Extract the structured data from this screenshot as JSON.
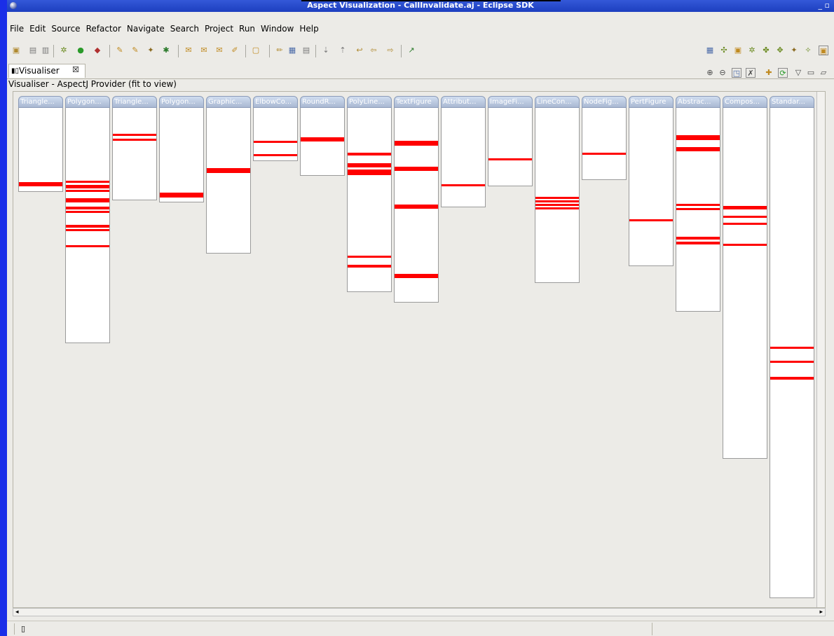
{
  "window": {
    "title": "Aspect Visualization - CallInvalidate.aj - Eclipse SDK",
    "controls": "_ ▫"
  },
  "menu": [
    "File",
    "Edit",
    "Source",
    "Refactor",
    "Navigate",
    "Search",
    "Project",
    "Run",
    "Window",
    "Help"
  ],
  "view": {
    "tab_label": "Visualiser",
    "close_glyph": "☒",
    "provider_label": "Visualiser - AspectJ Provider (fit to view)"
  },
  "colors": {
    "stripe": "#ff0000",
    "header": "#a9b8d2",
    "background": "#ecebe7"
  },
  "columns": [
    {
      "label": "Triangle...",
      "length": 120,
      "stripes": [
        {
          "at": 106,
          "size": 6
        }
      ]
    },
    {
      "label": "Polygon...",
      "length": 336,
      "stripes": [
        {
          "at": 104,
          "size": 3
        },
        {
          "at": 110,
          "size": 5
        },
        {
          "at": 117,
          "size": 3
        },
        {
          "at": 129,
          "size": 6
        },
        {
          "at": 141,
          "size": 4
        },
        {
          "at": 147,
          "size": 3
        },
        {
          "at": 167,
          "size": 4
        },
        {
          "at": 173,
          "size": 3
        },
        {
          "at": 196,
          "size": 3
        }
      ]
    },
    {
      "label": "Triangle...",
      "length": 132,
      "stripes": [
        {
          "at": 37,
          "size": 3
        },
        {
          "at": 44,
          "size": 3
        }
      ]
    },
    {
      "label": "Polygon...",
      "length": 135,
      "stripes": [
        {
          "at": 121,
          "size": 7
        }
      ]
    },
    {
      "label": "Graphic...",
      "length": 208,
      "stripes": [
        {
          "at": 86,
          "size": 7
        }
      ]
    },
    {
      "label": "ElbowCo...",
      "length": 76,
      "stripes": [
        {
          "at": 47,
          "size": 3
        },
        {
          "at": 66,
          "size": 3
        }
      ]
    },
    {
      "label": "RoundR...",
      "length": 97,
      "stripes": [
        {
          "at": 42,
          "size": 6
        }
      ]
    },
    {
      "label": "PolyLine...",
      "length": 263,
      "stripes": [
        {
          "at": 64,
          "size": 4
        },
        {
          "at": 79,
          "size": 6
        },
        {
          "at": 88,
          "size": 8
        },
        {
          "at": 211,
          "size": 3
        },
        {
          "at": 224,
          "size": 4
        }
      ]
    },
    {
      "label": "TextFigure",
      "length": 278,
      "stripes": [
        {
          "at": 47,
          "size": 7
        },
        {
          "at": 84,
          "size": 6
        },
        {
          "at": 138,
          "size": 6
        },
        {
          "at": 237,
          "size": 6
        }
      ]
    },
    {
      "label": "Attribut...",
      "length": 142,
      "stripes": [
        {
          "at": 109,
          "size": 3
        }
      ]
    },
    {
      "label": "ImageFi...",
      "length": 112,
      "stripes": [
        {
          "at": 72,
          "size": 3
        }
      ]
    },
    {
      "label": "LineCon...",
      "length": 250,
      "stripes": [
        {
          "at": 127,
          "size": 3
        },
        {
          "at": 132,
          "size": 3
        },
        {
          "at": 137,
          "size": 3
        },
        {
          "at": 142,
          "size": 3
        }
      ]
    },
    {
      "label": "NodeFig...",
      "length": 103,
      "stripes": [
        {
          "at": 64,
          "size": 3
        }
      ]
    },
    {
      "label": "PertFigure",
      "length": 226,
      "stripes": [
        {
          "at": 159,
          "size": 3
        }
      ]
    },
    {
      "label": "Abstrac...",
      "length": 291,
      "stripes": [
        {
          "at": 39,
          "size": 7
        },
        {
          "at": 56,
          "size": 6
        },
        {
          "at": 137,
          "size": 3
        },
        {
          "at": 143,
          "size": 3
        },
        {
          "at": 184,
          "size": 4
        },
        {
          "at": 191,
          "size": 4
        }
      ]
    },
    {
      "label": "Compos...",
      "length": 501,
      "stripes": [
        {
          "at": 140,
          "size": 5
        },
        {
          "at": 154,
          "size": 3
        },
        {
          "at": 164,
          "size": 3
        },
        {
          "at": 194,
          "size": 3
        }
      ]
    },
    {
      "label": "Standar...",
      "length": 700,
      "stripes": [
        {
          "at": 341,
          "size": 3
        },
        {
          "at": 361,
          "size": 3
        },
        {
          "at": 384,
          "size": 4
        }
      ]
    }
  ]
}
